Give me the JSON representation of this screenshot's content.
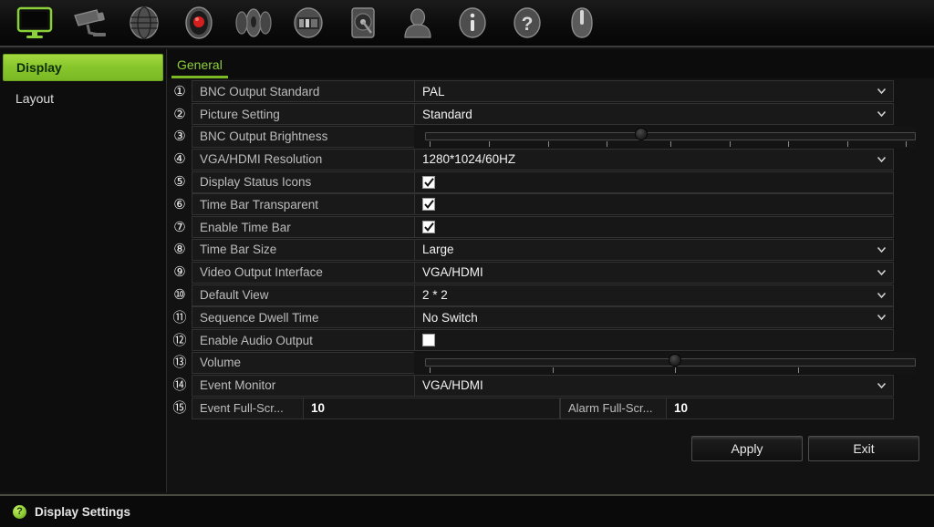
{
  "toolbar": {
    "items": [
      {
        "icon": "monitor-icon",
        "label": "Display",
        "active": true
      },
      {
        "icon": "camera-icon",
        "label": "Camera",
        "active": false
      },
      {
        "icon": "network-globe-icon",
        "label": "Network",
        "active": false
      },
      {
        "icon": "record-icon",
        "label": "Record",
        "active": false
      },
      {
        "icon": "alarm-icon",
        "label": "Alarm",
        "active": false
      },
      {
        "icon": "device-icon",
        "label": "Device",
        "active": false
      },
      {
        "icon": "hdd-icon",
        "label": "HDD",
        "active": false
      },
      {
        "icon": "user-icon",
        "label": "User",
        "active": false
      },
      {
        "icon": "info-icon",
        "label": "Info",
        "active": false
      },
      {
        "icon": "help-icon",
        "label": "Help",
        "active": false
      },
      {
        "icon": "power-icon",
        "label": "Shutdown",
        "active": false
      }
    ]
  },
  "sidebar": {
    "items": [
      {
        "label": "Display",
        "active": true
      },
      {
        "label": "Layout",
        "active": false
      }
    ]
  },
  "tabs": [
    {
      "label": "General",
      "active": true
    }
  ],
  "settings": {
    "rows": [
      {
        "num": "①",
        "label": "BNC Output Standard",
        "type": "select",
        "value": "PAL"
      },
      {
        "num": "②",
        "label": "Picture Setting",
        "type": "select",
        "value": "Standard"
      },
      {
        "num": "③",
        "label": "BNC Output Brightness",
        "type": "slider",
        "value": 50,
        "ticks": 9
      },
      {
        "num": "④",
        "label": "VGA/HDMI Resolution",
        "type": "select",
        "value": "1280*1024/60HZ"
      },
      {
        "num": "⑤",
        "label": "Display Status Icons",
        "type": "checkbox",
        "checked": true
      },
      {
        "num": "⑥",
        "label": "Time Bar Transparent",
        "type": "checkbox",
        "checked": true
      },
      {
        "num": "⑦",
        "label": "Enable Time Bar",
        "type": "checkbox",
        "checked": true
      },
      {
        "num": "⑧",
        "label": "Time Bar Size",
        "type": "select",
        "value": "Large"
      },
      {
        "num": "⑨",
        "label": "Video Output Interface",
        "type": "select",
        "value": "VGA/HDMI"
      },
      {
        "num": "⑩",
        "label": "Default View",
        "type": "select",
        "value": "2 * 2"
      },
      {
        "num": "⑪",
        "label": "Sequence Dwell Time",
        "type": "select",
        "value": "No Switch"
      },
      {
        "num": "⑫",
        "label": "Enable Audio Output",
        "type": "checkbox",
        "checked": false
      },
      {
        "num": "⑬",
        "label": "Volume",
        "type": "slider",
        "value": 50,
        "ticks": 4
      },
      {
        "num": "⑭",
        "label": "Event Monitor",
        "type": "select",
        "value": "VGA/HDMI"
      },
      {
        "num": "⑮",
        "type": "pair",
        "label_a": "Event Full-Scr...",
        "value_a": "10",
        "label_b": "Alarm Full-Scr...",
        "value_b": "10"
      }
    ]
  },
  "buttons": {
    "apply": "Apply",
    "exit": "Exit"
  },
  "statusbar": {
    "icon": "help-question-icon",
    "glyph": "?",
    "text": "Display Settings"
  },
  "colors": {
    "accent_green": "#86c52b",
    "tab_green": "#8fcf3a",
    "panel_bg": "#121212",
    "row_bg": "#191919",
    "border": "#323232"
  }
}
